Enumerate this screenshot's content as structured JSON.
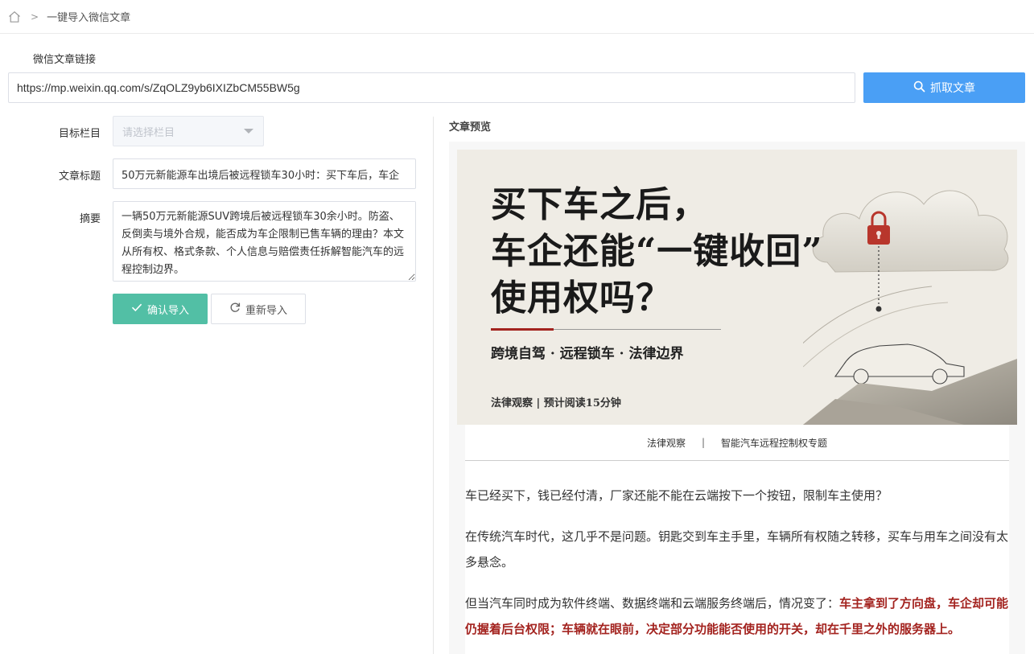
{
  "breadcrumb": {
    "home_icon": "home-icon",
    "separator": ">",
    "current": "一键导入微信文章"
  },
  "url_section": {
    "label": "微信文章链接",
    "url_value": "https://mp.weixin.qq.com/s/ZqOLZ9yb6IXIZbCM55BW5g",
    "fetch_button": "抓取文章",
    "fetch_icon": "search-icon",
    "accent": "#4a9ff5"
  },
  "form": {
    "category_label": "目标栏目",
    "category_placeholder": "请选择栏目",
    "title_label": "文章标题",
    "title_value": "50万元新能源车出境后被远程锁车30小时：买下车后，车企",
    "summary_label": "摘要",
    "summary_value": "一辆50万元新能源SUV跨境后被远程锁车30余小时。防盗、反倒卖与境外合规，能否成为车企限制已售车辆的理由？本文从所有权、格式条款、个人信息与赔偿责任拆解智能汽车的远程控制边界。",
    "confirm_button": "确认导入",
    "confirm_color": "#52bfa5",
    "reset_button": "重新导入"
  },
  "preview": {
    "label": "文章预览",
    "banner": {
      "title_lines": [
        "买下车之后，",
        "车企还能“一键收回”",
        "使用权吗？"
      ],
      "subtitle": "跨境自驾 · 远程锁车 · 法律边界",
      "meta": "法律观察 | 预计阅读15分钟"
    },
    "caption_left": "法律观察",
    "caption_sep": "|",
    "caption_right": "智能汽车远程控制权专题",
    "paragraphs": {
      "p1": "车已经买下，钱已经付清，厂家还能不能在云端按下一个按钮，限制车主使用？",
      "p2": "在传统汽车时代，这几乎不是问题。钥匙交到车主手里，车辆所有权随之转移，买车与用车之间没有太多悬念。",
      "p3_plain": "但当汽车同时成为软件终端、数据终端和云端服务终端后，情况变了：",
      "p3_highlight": "车主拿到了方向盘，车企却可能仍握着后台权限；车辆就在眼前，决定部分功能能否使用的开关，却在千里之外的服务器上。"
    },
    "highlight_color": "#a3231f"
  }
}
